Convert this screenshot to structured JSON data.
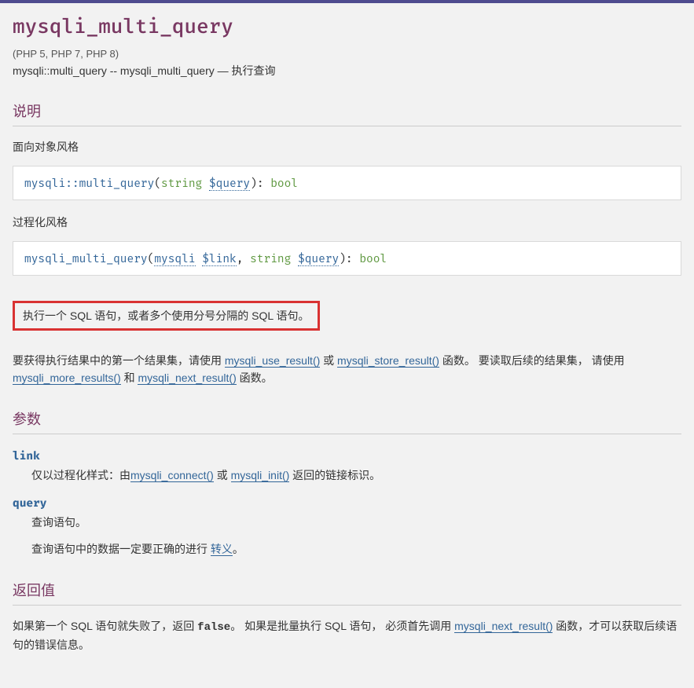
{
  "header": {
    "title": "mysqli_multi_query",
    "versions": "(PHP 5, PHP 7, PHP 8)",
    "purpose": "mysqli::multi_query -- mysqli_multi_query — 执行查询"
  },
  "sections": {
    "description": {
      "heading": "说明",
      "oo_label": "面向对象风格",
      "synopsis_oo": {
        "method": "mysqli::multi_query",
        "lparen": "(",
        "p1_type": "string",
        "p1_name": "$query",
        "rparen": "): ",
        "ret": "bool"
      },
      "proc_label": "过程化风格",
      "synopsis_proc": {
        "func": "mysqli_multi_query",
        "lparen": "(",
        "p1_type": "mysqli",
        "p1_name": "$link",
        "sep": ", ",
        "p2_type": "string",
        "p2_name": "$query",
        "rparen": "): ",
        "ret": "bool"
      },
      "highlight_text": "执行一个 SQL 语句，或者多个使用分号分隔的 SQL 语句。",
      "para2_pre": "要获得执行结果中的第一个结果集，请使用 ",
      "link_use_result": "mysqli_use_result()",
      "para2_or": " 或 ",
      "link_store_result": "mysqli_store_result()",
      "para2_mid": " 函数。 要读取后续的结果集， 请使用 ",
      "link_more_results": "mysqli_more_results()",
      "para2_and": " 和 ",
      "link_next_result": "mysqli_next_result()",
      "para2_end": " 函数。"
    },
    "parameters": {
      "heading": "参数",
      "items": [
        {
          "name": "link",
          "desc_pre": "仅以过程化样式：由",
          "link1": "mysqli_connect()",
          "desc_or": " 或 ",
          "link2": "mysqli_init()",
          "desc_post": " 返回的链接标识。"
        },
        {
          "name": "query",
          "desc1": "查询语句。",
          "desc2_pre": "查询语句中的数据一定要正确的进行 ",
          "link_escape": "转义",
          "desc2_post": "。"
        }
      ]
    },
    "returnvalues": {
      "heading": "返回值",
      "para_pre": "如果第一个 SQL 语句就失败了，返回 ",
      "false_kw": "false",
      "para_mid1": "。 如果是批量执行 SQL 语句， 必须首先调用 ",
      "link_next_result": "mysqli_next_result()",
      "para_post": " 函数，才可以获取后续语句的错误信息。"
    }
  }
}
